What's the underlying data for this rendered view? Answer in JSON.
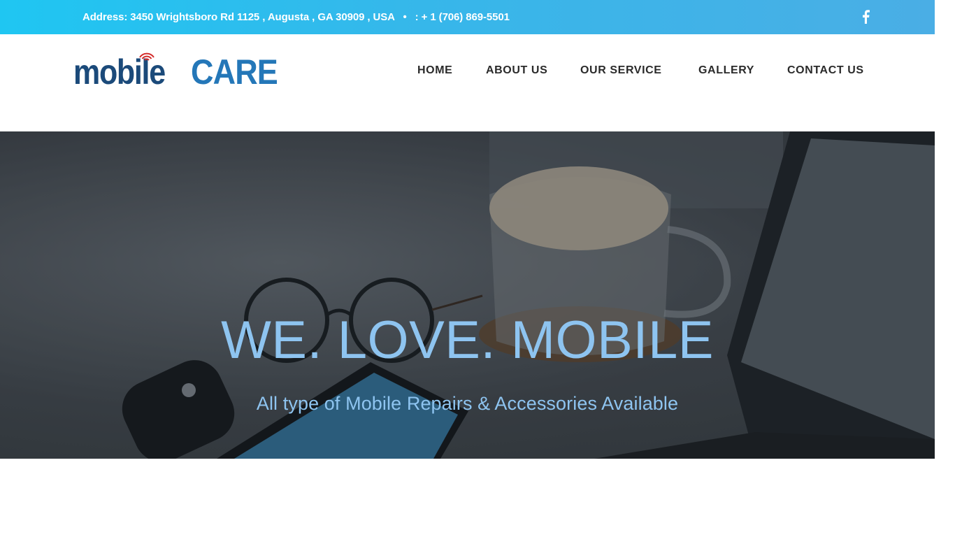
{
  "topbar": {
    "address": "Address: 3450 Wrightsboro Rd 1125 , Augusta , GA 30909 , USA",
    "separator": "•",
    "phone": ": + 1 (706) 869-5501",
    "social_icon": "facebook-icon"
  },
  "logo": {
    "word1": "mobile",
    "word2": "CARE",
    "colors": {
      "primary": "#1b4a7a",
      "secondary": "#2477b8",
      "signal": "#d42a2a"
    }
  },
  "nav": {
    "items": [
      {
        "label": "HOME"
      },
      {
        "label": "ABOUT US"
      },
      {
        "label": "OUR SERVICE"
      },
      {
        "label": "GALLERY"
      },
      {
        "label": "CONTACT US"
      }
    ]
  },
  "hero": {
    "headline": "WE. LOVE. MOBILE",
    "subheadline": "All type of Mobile Repairs & Accessories Available",
    "text_color": "#8ec4f0"
  }
}
